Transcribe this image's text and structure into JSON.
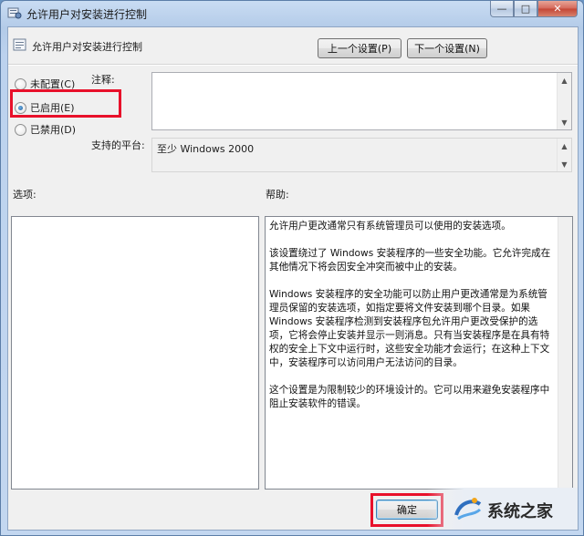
{
  "window": {
    "title": "允许用户对安装进行控制",
    "controls": {
      "minimize": "—",
      "maximize": "□",
      "close": "✕"
    }
  },
  "header": {
    "policy_name": "允许用户对安装进行控制",
    "prev_button": "上一个设置(P)",
    "next_button": "下一个设置(N)"
  },
  "state": {
    "options": [
      {
        "label": "未配置(C)",
        "selected": false
      },
      {
        "label": "已启用(E)",
        "selected": true
      },
      {
        "label": "已禁用(D)",
        "selected": false
      }
    ],
    "highlight_color": "#e8102a"
  },
  "comment": {
    "label": "注释:",
    "value": ""
  },
  "supported": {
    "label": "支持的平台:",
    "value": "至少 Windows 2000"
  },
  "options_section": {
    "label": "选项:"
  },
  "help_section": {
    "label": "帮助:",
    "paragraphs": [
      "允许用户更改通常只有系统管理员可以使用的安装选项。",
      "该设置绕过了 Windows 安装程序的一些安全功能。它允许完成在其他情况下将会因安全冲突而被中止的安装。",
      "Windows 安装程序的安全功能可以防止用户更改通常是为系统管理员保留的安装选项，如指定要将文件安装到哪个目录。如果 Windows 安装程序检测到安装程序包允许用户更改受保护的选项，它将会停止安装并显示一则消息。只有当安装程序是在具有特权的安全上下文中运行时，这些安全功能才会运行；在这种上下文中，安装程序可以访问用户无法访问的目录。",
      "这个设置是为限制较少的环境设计的。它可以用来避免安装程序中阻止安装软件的错误。"
    ]
  },
  "footer": {
    "ok_button": "确定",
    "watermark_text": "系统之家"
  }
}
